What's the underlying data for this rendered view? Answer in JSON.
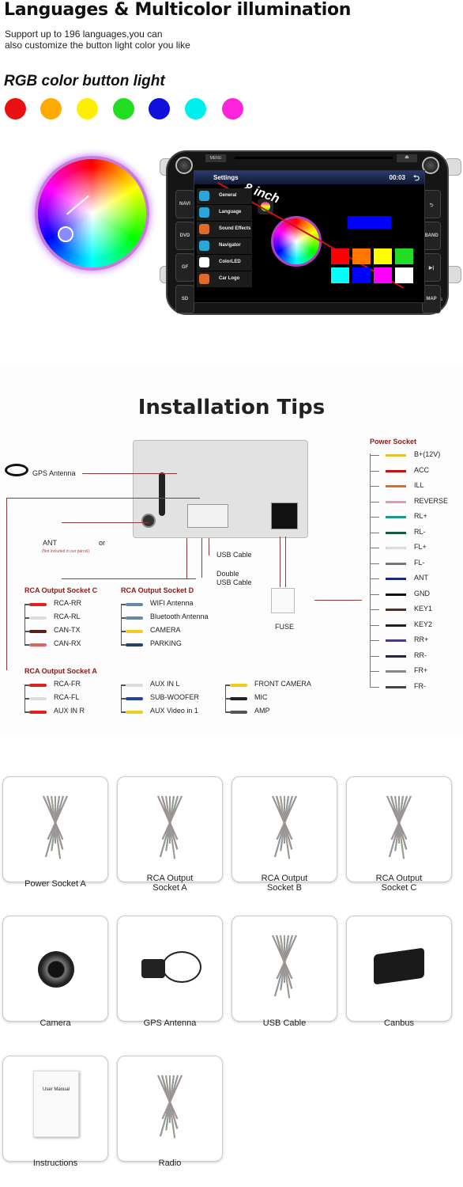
{
  "header": {
    "title": "Languages & Multicolor illumination",
    "subtitle_line1": "Support up to 196 languages,you can",
    "subtitle_line2": "also customize the button light color you like",
    "rgb_heading": "RGB color button light"
  },
  "button_colors": [
    "#e81010",
    "#ffaa00",
    "#ffee00",
    "#22dd22",
    "#1010dd",
    "#00eeee",
    "#ff22dd"
  ],
  "stereo": {
    "top_buttons": [
      "MENU",
      "⏏"
    ],
    "left_buttons": [
      "NAVI",
      "DVD",
      "GF",
      "SD"
    ],
    "right_buttons": [
      "⮌",
      "BAND",
      "▶|",
      "MAP"
    ],
    "reset_label": "RES",
    "status_title": "Settings",
    "status_time": "00:03",
    "size_label": "8 inch",
    "menu": [
      {
        "label": "General",
        "color": "#2aa7d8"
      },
      {
        "label": "Language",
        "color": "#2aa7d8"
      },
      {
        "label": "Sound Effects",
        "color": "#e06a2a"
      },
      {
        "label": "Navigator",
        "color": "#2aa7d8"
      },
      {
        "label": "ColorLED",
        "color": "#ffffff"
      },
      {
        "label": "Car Logo",
        "color": "#e06a2a"
      }
    ],
    "swatches": [
      "#ff0000",
      "#ff7700",
      "#ffff00",
      "#22dd22",
      "#00ffff",
      "#0000ff",
      "#ff00ff",
      "#ffffff"
    ],
    "selected_color": "#0000ff"
  },
  "install": {
    "title": "Installation Tips",
    "gps": "GPS Antenna",
    "ant": "ANT",
    "or": "or",
    "not_included": "(Not included in our parcel)",
    "usb": "USB Cable",
    "double_usb_1": "Double",
    "double_usb_2": "USB Cable",
    "fuse": "FUSE",
    "socket_c": {
      "title": "RCA Output Socket C",
      "items": [
        {
          "label": "RCA-RR",
          "color": "#dd2222"
        },
        {
          "label": "RCA-RL",
          "color": "#dddddd"
        },
        {
          "label": "CAN-TX",
          "color": "#552222"
        },
        {
          "label": "CAN-RX",
          "color": "#dd6666"
        }
      ]
    },
    "socket_d": {
      "title": "RCA Output Socket D",
      "items": [
        {
          "label": "WIFI Antenna",
          "color": "#6688aa"
        },
        {
          "label": "Bluetooth Antenna",
          "color": "#6688aa"
        },
        {
          "label": "CAMERA",
          "color": "#eecc22"
        },
        {
          "label": "PARKING",
          "color": "#224466"
        }
      ]
    },
    "socket_a": {
      "title": "RCA Output Socket A",
      "items": [
        {
          "label": "RCA-FR",
          "color": "#dd2222"
        },
        {
          "label": "RCA-FL",
          "color": "#dddddd"
        },
        {
          "label": "AUX IN R",
          "color": "#dd2222"
        }
      ]
    },
    "socket_b_items": [
      {
        "label": "AUX IN L",
        "color": "#dddddd"
      },
      {
        "label": "SUB-WOOFER",
        "color": "#2244aa"
      },
      {
        "label": "AUX Video in 1",
        "color": "#eecc22"
      }
    ],
    "misc_items": [
      {
        "label": "FRONT CAMERA",
        "color": "#eecc22"
      },
      {
        "label": "MIC",
        "color": "#222222"
      },
      {
        "label": "AMP",
        "color": "#555555"
      }
    ],
    "power": {
      "title": "Power Socket",
      "items": [
        {
          "label": "B+(12V)",
          "color": "#e8c030"
        },
        {
          "label": "ACC",
          "color": "#cc1111"
        },
        {
          "label": "ILL",
          "color": "#e06a20"
        },
        {
          "label": "REVERSE",
          "color": "#e898a8"
        },
        {
          "label": "RL+",
          "color": "#1a9a80"
        },
        {
          "label": "RL-",
          "color": "#155a40"
        },
        {
          "label": "FL+",
          "color": "#f4f4f4"
        },
        {
          "label": "FL-",
          "color": "#777777"
        },
        {
          "label": "ANT",
          "color": "#1a2a80"
        },
        {
          "label": "GND",
          "color": "#111111"
        },
        {
          "label": "KEY1",
          "color": "#5a2a1a"
        },
        {
          "label": "KEY2",
          "color": "#222222"
        },
        {
          "label": "RR+",
          "color": "#4a3a8a"
        },
        {
          "label": "RR-",
          "color": "#2a2040"
        },
        {
          "label": "FR+",
          "color": "#888888"
        },
        {
          "label": "FR-",
          "color": "#444444"
        }
      ]
    }
  },
  "accessories": [
    {
      "label": "Power Socket A",
      "icon": "wire-harness-icon"
    },
    {
      "label": "RCA Output\nSocket A",
      "icon": "rca-cable-icon"
    },
    {
      "label": "RCA Output\nSocket B",
      "icon": "rca-cable-icon"
    },
    {
      "label": "RCA Output\nSocket C",
      "icon": "rca-cable-icon"
    },
    {
      "label": "Camera",
      "icon": "camera-icon"
    },
    {
      "label": "GPS Antenna",
      "icon": "gps-antenna-icon"
    },
    {
      "label": "USB Cable",
      "icon": "usb-cable-icon"
    },
    {
      "label": "Canbus",
      "icon": "canbus-box-icon"
    },
    {
      "label": "Instructions",
      "icon": "manual-icon",
      "manual_title": "User Manual"
    },
    {
      "label": "Radio",
      "icon": "radio-cable-icon"
    }
  ]
}
